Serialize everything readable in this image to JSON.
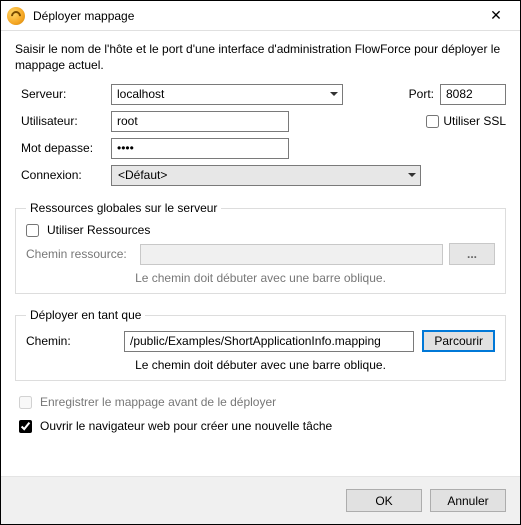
{
  "window": {
    "title": "Déployer mappage"
  },
  "intro": "Saisir le nom de l'hôte et le port d'une interface d'administration FlowForce pour déployer le mappage actuel.",
  "labels": {
    "server": "Serveur:",
    "port": "Port:",
    "user": "Utilisateur:",
    "ssl": "Utiliser SSL",
    "password": "Mot depasse:",
    "connection": "Connexion:"
  },
  "fields": {
    "server": "localhost",
    "port": "8082",
    "user": "root",
    "password": "••••",
    "connection": "<Défaut>"
  },
  "resources": {
    "legend": "Ressources globales sur le serveur",
    "use_label": "Utiliser Ressources",
    "path_label": "Chemin ressource:",
    "ellipsis": "...",
    "hint": "Le chemin doit débuter avec une barre oblique."
  },
  "deploy": {
    "legend": "Déployer en tant que",
    "path_label": "Chemin:",
    "path_value": "/public/Examples/ShortApplicationInfo.mapping",
    "browse": "Parcourir",
    "hint": "Le chemin doit débuter avec une barre oblique."
  },
  "checks": {
    "save_before": "Enregistrer le mappage avant de le déployer",
    "open_browser": "Ouvrir le navigateur web pour créer une nouvelle tâche"
  },
  "footer": {
    "ok": "OK",
    "cancel": "Annuler"
  }
}
